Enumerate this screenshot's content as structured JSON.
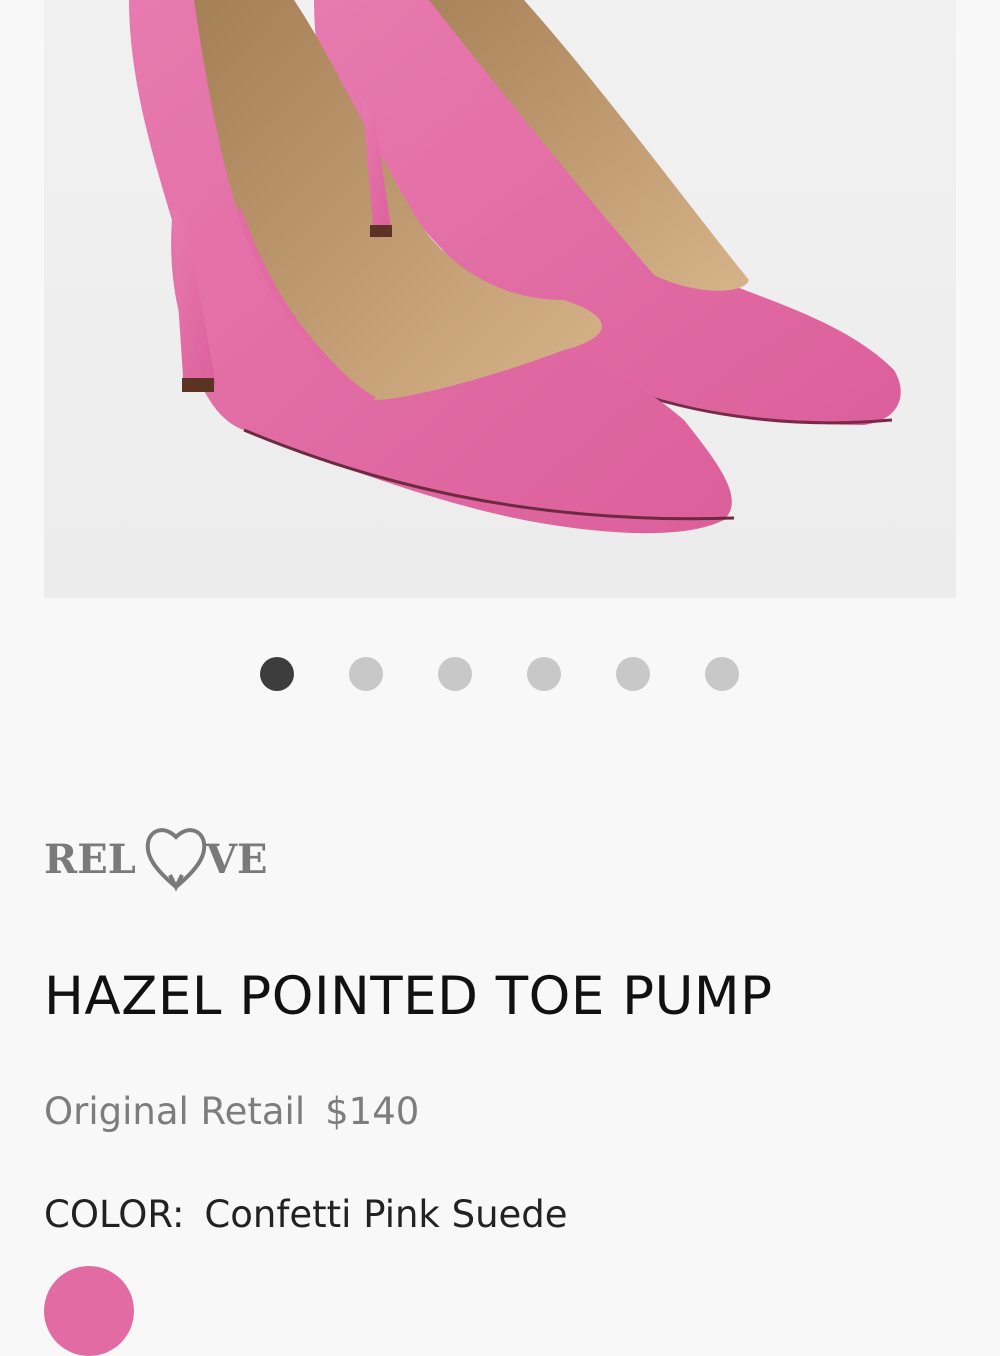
{
  "product": {
    "brand_logo_text": "RELOVE",
    "title": "HAZEL POINTED TOE PUMP",
    "retail_label": "Original Retail",
    "retail_price": "$140",
    "color_label": "COLOR:",
    "color_value": "Confetti Pink Suede",
    "swatch_color": "#e26ba3"
  },
  "carousel": {
    "count": 6,
    "active_index": 0,
    "active_color": "#3d3d3d",
    "inactive_color": "#c8c8c8"
  },
  "colors": {
    "background": "#f8f8f8",
    "suede_pink": "#e26ba3",
    "lining": "#c9a47c"
  }
}
